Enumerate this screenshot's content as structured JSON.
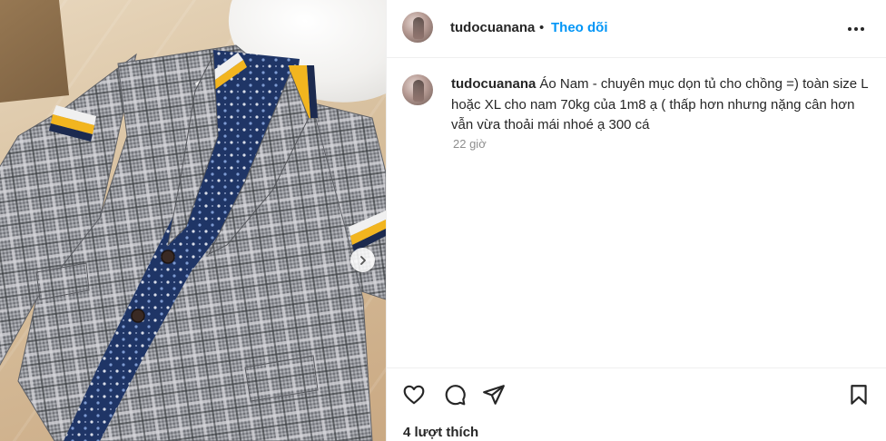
{
  "post": {
    "author": "tudocuanana",
    "separator": "•",
    "follow_label": "Theo dõi",
    "more_icon": "more-horizontal-icon",
    "caption_text": "Áo Nam - chuyên mục dọn tủ cho chồng =) toàn size L hoặc XL cho nam 70kg của 1m8 ạ ( thấp hơn nhưng nặng cân hơn vẫn vừa thoải mái nhoé ạ 300 cá",
    "time_ago": "22 giờ",
    "likes_text": "4 lượt thích"
  },
  "media": {
    "image_description_icon": "photo",
    "next_icon": "chevron-right-icon"
  },
  "actions": {
    "like_icon": "heart-icon",
    "comment_icon": "comment-icon",
    "share_icon": "send-icon",
    "save_icon": "bookmark-icon"
  },
  "colors": {
    "follow": "#0095f6",
    "text": "#262626",
    "muted": "#8e8e8e",
    "border": "#efefef"
  }
}
